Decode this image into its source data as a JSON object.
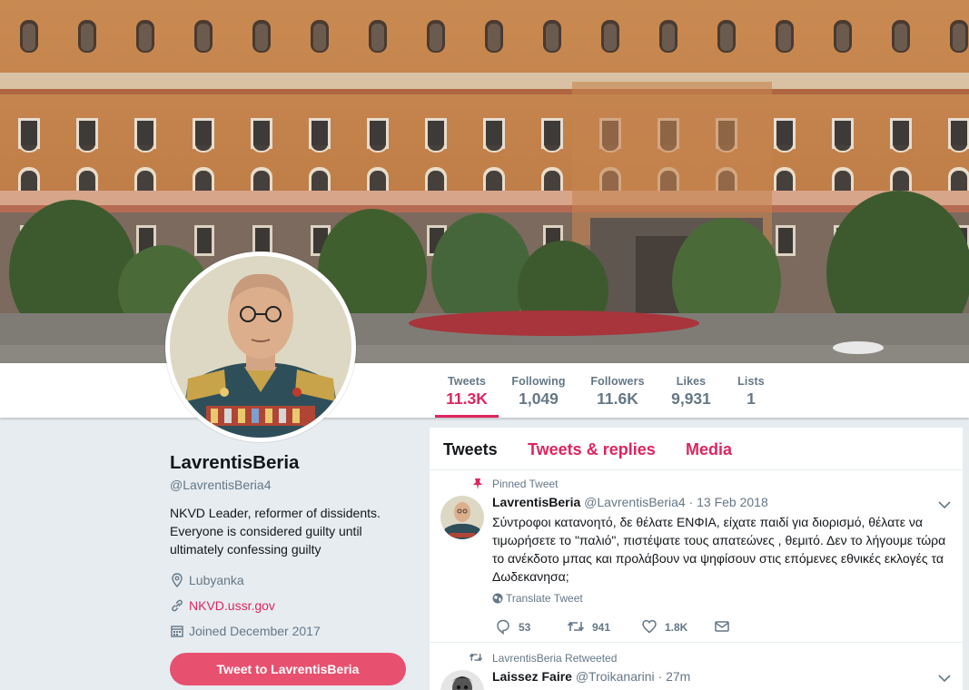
{
  "colors": {
    "accent": "#e0245e",
    "button": "#e8506f",
    "muted": "#657786",
    "background": "#e6ecf0"
  },
  "nav": {
    "stats": [
      {
        "label": "Tweets",
        "value": "11.3K",
        "active": true
      },
      {
        "label": "Following",
        "value": "1,049"
      },
      {
        "label": "Followers",
        "value": "11.6K"
      },
      {
        "label": "Likes",
        "value": "9,931"
      },
      {
        "label": "Lists",
        "value": "1"
      }
    ]
  },
  "profile": {
    "name": "LavrentisBeria",
    "handle": "@LavrentisBeria4",
    "bio": "NKVD Leader, reformer of dissidents. Everyone is considered guilty until ultimately confessing guilty",
    "location": "Lubyanka",
    "location_icon": "location-pin-icon",
    "website": "NKVD.ussr.gov",
    "website_icon": "link-icon",
    "joined": "Joined December 2017",
    "joined_icon": "calendar-icon",
    "tweet_to_label": "Tweet to LavrentisBeria"
  },
  "timeline": {
    "tabs": [
      "Tweets",
      "Tweets & replies",
      "Media"
    ],
    "pinned": {
      "context": "Pinned Tweet",
      "name": "LavrentisBeria",
      "handle": "@LavrentisBeria4",
      "date": "· 13 Feb 2018",
      "text": "Σύντροφοι κατανοητό, δε θέλατε ΕΝΦΙΑ, είχατε παιδί για διορισμό, θέλατε να τιμωρήσετε το \"παλιό\", πιστέψατε τους απατεώνες , θεμιτό. Δεν  το λήγουμε τώρα το ανέκδοτο μπας και προλάβουν να ψηφίσουν στις επόμενες εθνικές εκλογές τα Δωδεκανησα;",
      "translate": "Translate Tweet",
      "replies": "53",
      "retweets": "941",
      "likes": "1.8K"
    },
    "retweeted": {
      "context": "LavrentisBeria Retweeted",
      "name": "Laissez Faire",
      "handle": "@Troikanarini",
      "time": "· 27m"
    }
  }
}
